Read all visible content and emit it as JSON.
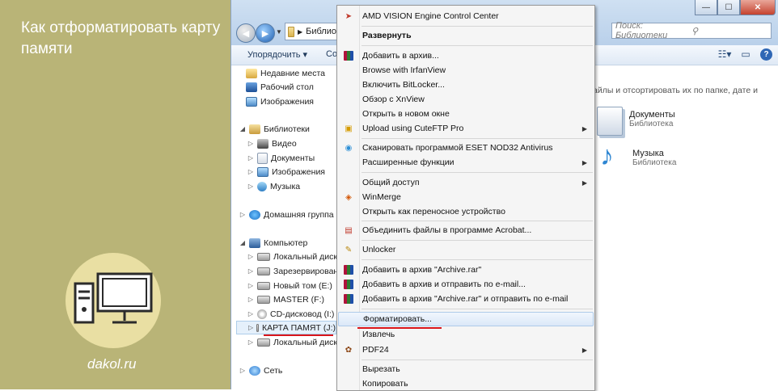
{
  "promo": {
    "title": "Как отформатировать карту памяти",
    "site": "dakol.ru"
  },
  "window": {
    "address": "Библио",
    "search_placeholder": "Поиск: Библиотеки",
    "toolbar": {
      "organize": "Упорядочить ▾",
      "cut_label": "Со"
    },
    "buttons": {
      "minimize": "—",
      "maximize": "☐",
      "close": "✕"
    }
  },
  "navpane": {
    "items": [
      {
        "label": "Недавние места"
      },
      {
        "label": "Рабочий стол"
      },
      {
        "label": "Изображения"
      },
      {
        "label": "Библиотеки"
      },
      {
        "label": "Видео"
      },
      {
        "label": "Документы"
      },
      {
        "label": "Изображения"
      },
      {
        "label": "Музыка"
      },
      {
        "label": "Домашняя группа"
      },
      {
        "label": "Компьютер"
      },
      {
        "label": "Локальный диск (("
      },
      {
        "label": "Зарезервировано"
      },
      {
        "label": "Новый том (E:)"
      },
      {
        "label": "MASTER (F:)"
      },
      {
        "label": "CD-дисковод (I:)"
      },
      {
        "label": "КАРТА ПАМЯТ (J:)"
      },
      {
        "label": "Локальный диск (Z"
      },
      {
        "label": "Сеть"
      }
    ]
  },
  "content": {
    "hint": "айлы и отсортировать их по папке, дате и",
    "libraries": [
      {
        "name": "Документы",
        "type": "Библиотека"
      },
      {
        "name": "Музыка",
        "type": "Библиотека"
      }
    ]
  },
  "menu": {
    "items": [
      {
        "label": "AMD VISION Engine Control Center"
      },
      {
        "label": "Развернуть"
      },
      {
        "label": "Добавить в архив..."
      },
      {
        "label": "Browse with IrfanView"
      },
      {
        "label": "Включить BitLocker..."
      },
      {
        "label": "Обзор с XnView"
      },
      {
        "label": "Открыть в новом окне"
      },
      {
        "label": "Upload using CuteFTP Pro"
      },
      {
        "label": "Сканировать программой ESET NOD32 Antivirus"
      },
      {
        "label": "Расширенные функции"
      },
      {
        "label": "Общий доступ"
      },
      {
        "label": "WinMerge"
      },
      {
        "label": "Открыть как переносное устройство"
      },
      {
        "label": "Объединить файлы в программе Acrobat..."
      },
      {
        "label": "Unlocker"
      },
      {
        "label": "Добавить в архив \"Archive.rar\""
      },
      {
        "label": "Добавить в архив и отправить по e-mail..."
      },
      {
        "label": "Добавить в архив \"Archive.rar\" и отправить по e-mail"
      },
      {
        "label": "Форматировать..."
      },
      {
        "label": "Извлечь"
      },
      {
        "label": "PDF24"
      },
      {
        "label": "Вырезать"
      },
      {
        "label": "Копировать"
      }
    ]
  },
  "colors": {
    "promo_bg": "#b9b477",
    "highlight_underline": "#d9151b"
  }
}
